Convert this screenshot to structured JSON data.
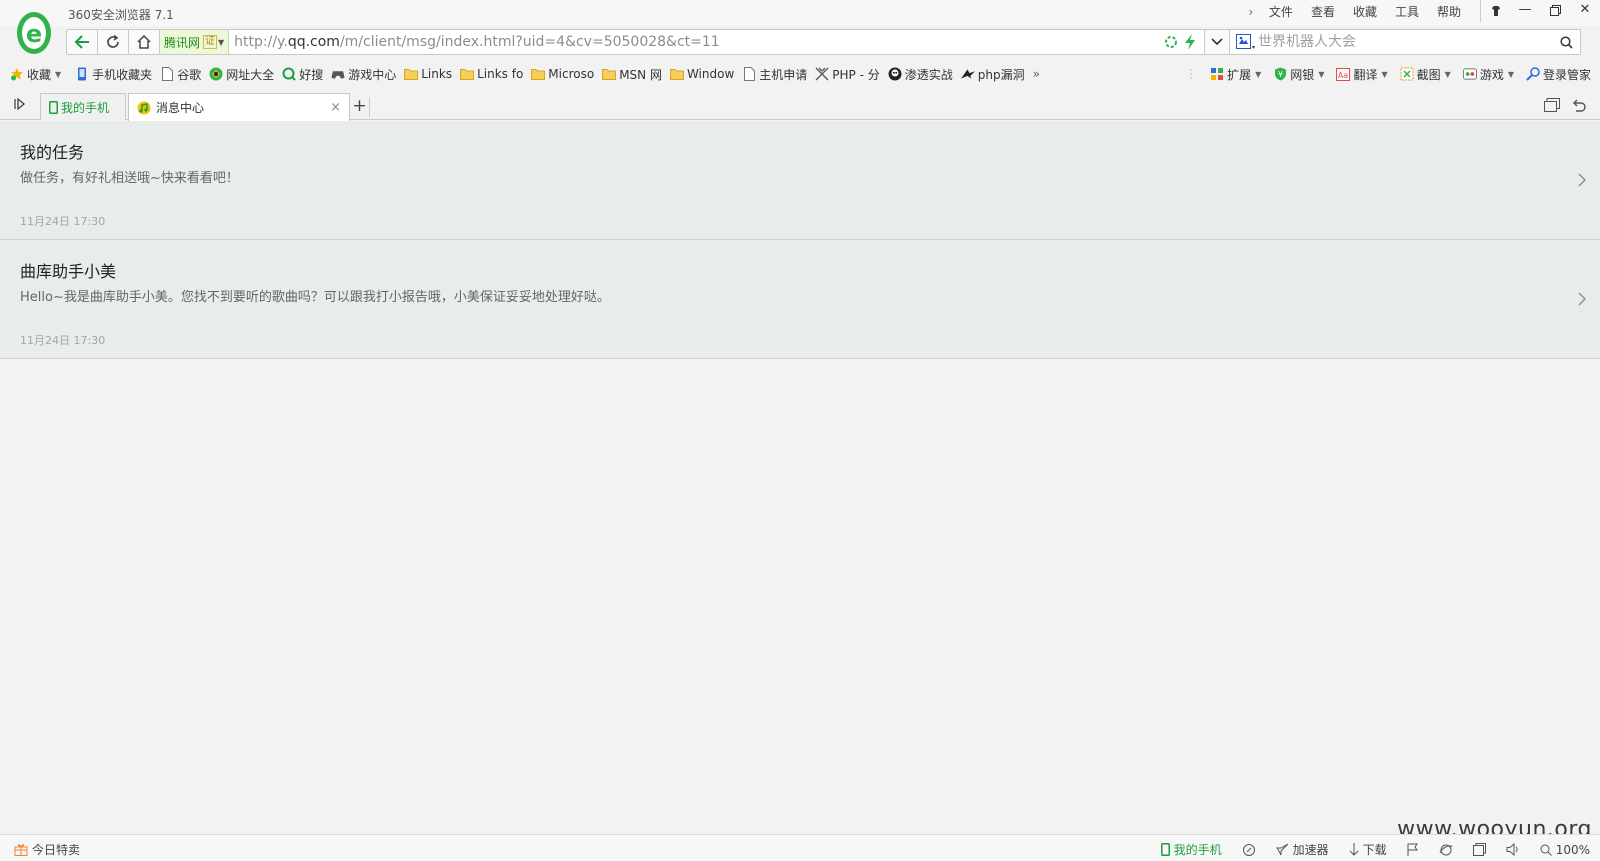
{
  "app": {
    "title": "360安全浏览器 7.1"
  },
  "menu": [
    "文件",
    "查看",
    "收藏",
    "工具",
    "帮助"
  ],
  "address": {
    "cert_label": "腾讯网",
    "cert_badge": "证",
    "url_prefix": "http://y.",
    "url_host": "qq.com",
    "url_path": "/m/client/msg/index.html?uid=4&cv=5050028&ct=11",
    "search_placeholder": "世界机器人大会"
  },
  "favorites": [
    {
      "label": "收藏",
      "icon": "star-icon"
    },
    {
      "label": "手机收藏夹",
      "icon": "phone-icon"
    },
    {
      "label": "谷歌",
      "icon": "page-icon"
    },
    {
      "label": "网址大全",
      "icon": "globe-icon"
    },
    {
      "label": "好搜",
      "icon": "search-q-icon"
    },
    {
      "label": "游戏中心",
      "icon": "gamepad-icon"
    },
    {
      "label": "Links",
      "icon": "folder-icon"
    },
    {
      "label": "Links fo",
      "icon": "folder-icon"
    },
    {
      "label": "Microso",
      "icon": "folder-icon"
    },
    {
      "label": "MSN 网",
      "icon": "folder-icon"
    },
    {
      "label": "Window",
      "icon": "folder-icon"
    },
    {
      "label": "主机申请",
      "icon": "page-icon"
    },
    {
      "label": "PHP - 分",
      "icon": "tools-icon"
    },
    {
      "label": "渗透实战",
      "icon": "skull-icon"
    },
    {
      "label": "php漏洞",
      "icon": "bird-icon"
    }
  ],
  "toolbar_right": [
    {
      "label": "扩展",
      "icon": "grid-icon"
    },
    {
      "label": "网银",
      "icon": "shield-icon"
    },
    {
      "label": "翻译",
      "icon": "translate-icon"
    },
    {
      "label": "截图",
      "icon": "scissors-icon"
    },
    {
      "label": "游戏",
      "icon": "game-icon"
    },
    {
      "label": "登录管家",
      "icon": "key-icon"
    }
  ],
  "tabs": [
    {
      "label": "我的手机"
    },
    {
      "label": "消息中心"
    }
  ],
  "messages": [
    {
      "title": "我的任务",
      "desc": "做任务，有好礼相送哦~快来看看吧！",
      "time": "11月24日 17:30"
    },
    {
      "title": "曲库助手小美",
      "desc": "Hello~我是曲库助手小美。您找不到要听的歌曲吗？可以跟我打小报告哦，小美保证妥妥地处理好哒。",
      "time": "11月24日 17:30"
    }
  ],
  "status": {
    "left": "今日特卖",
    "phone": "我的手机",
    "accel": "加速器",
    "download": "下载",
    "zoom": "100%"
  },
  "watermark": "www.wooyun.org",
  "colors": {
    "accent_green": "#1a9e3f",
    "message_bg": "#e8ecea"
  }
}
